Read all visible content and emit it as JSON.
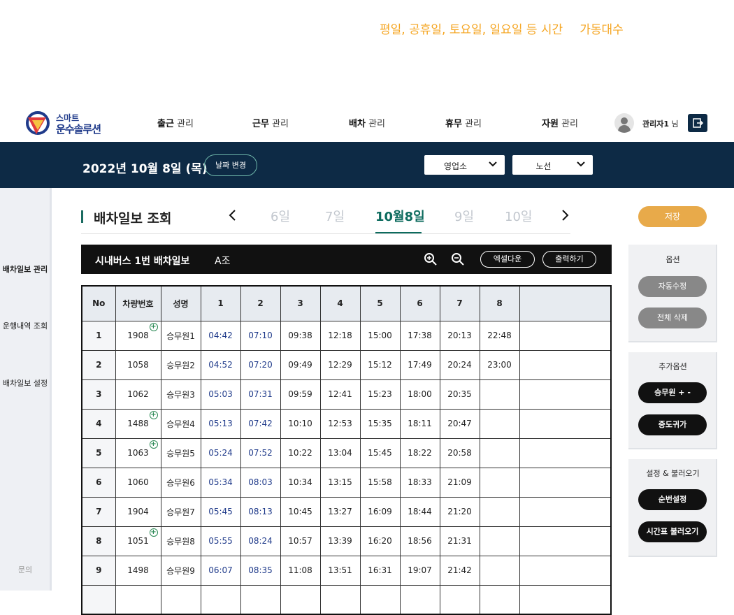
{
  "top_note": [
    "평일, 공휴일, 토요일, 일요일 등 시간",
    "가동대수"
  ],
  "logo": {
    "sub": "스마트",
    "main": "운수솔루션"
  },
  "menu": [
    {
      "bold": "출근",
      "rest": "관리"
    },
    {
      "bold": "근무",
      "rest": "관리"
    },
    {
      "bold": "배차",
      "rest": "관리"
    },
    {
      "bold": "휴무",
      "rest": "관리"
    },
    {
      "bold": "자원",
      "rest": "관리"
    }
  ],
  "user": {
    "name": "관리자1",
    "suffix": "님"
  },
  "datebar": {
    "date": "2022년 10월 8일 (목)",
    "change_label": "날짜 변경",
    "office_select": "영업소",
    "route_select": "노선"
  },
  "sidebar": {
    "items": [
      "배차일보 관리",
      "운행내역 조회",
      "배차일보 설정"
    ],
    "bottom": "문의"
  },
  "page": {
    "title": "배차일보 조회",
    "days": [
      "6일",
      "7일",
      "10월8일",
      "9일",
      "10일"
    ],
    "save_label": "저장"
  },
  "table_header": {
    "title": "시내버스 1번 배차일보",
    "group": "A조",
    "excel_label": "엑셀다운",
    "print_label": "출력하기"
  },
  "table": {
    "columns": [
      "No",
      "차량번호",
      "성명",
      "1",
      "2",
      "3",
      "4",
      "5",
      "6",
      "7",
      "8",
      ""
    ],
    "rows": [
      {
        "no": "1",
        "vehicle": "1908",
        "plus": true,
        "name": "승무원1",
        "times": [
          "04:42",
          "07:10",
          "09:38",
          "12:18",
          "15:00",
          "17:38",
          "20:13",
          "22:48"
        ]
      },
      {
        "no": "2",
        "vehicle": "1058",
        "plus": false,
        "name": "승무원2",
        "times": [
          "04:52",
          "07:20",
          "09:49",
          "12:29",
          "15:12",
          "17:49",
          "20:24",
          "23:00"
        ]
      },
      {
        "no": "3",
        "vehicle": "1062",
        "plus": false,
        "name": "승무원3",
        "times": [
          "05:03",
          "07:31",
          "09:59",
          "12:41",
          "15:23",
          "18:00",
          "20:35",
          ""
        ]
      },
      {
        "no": "4",
        "vehicle": "1488",
        "plus": true,
        "name": "승무원4",
        "times": [
          "05:13",
          "07:42",
          "10:10",
          "12:53",
          "15:35",
          "18:11",
          "20:47",
          ""
        ]
      },
      {
        "no": "5",
        "vehicle": "1063",
        "plus": true,
        "name": "승무원5",
        "times": [
          "05:24",
          "07:52",
          "10:22",
          "13:04",
          "15:45",
          "18:22",
          "20:58",
          ""
        ]
      },
      {
        "no": "6",
        "vehicle": "1060",
        "plus": false,
        "name": "승무원6",
        "times": [
          "05:34",
          "08:03",
          "10:34",
          "13:15",
          "15:58",
          "18:33",
          "21:09",
          ""
        ]
      },
      {
        "no": "7",
        "vehicle": "1904",
        "plus": false,
        "name": "승무원7",
        "times": [
          "05:45",
          "08:13",
          "10:45",
          "13:27",
          "16:09",
          "18:44",
          "21:20",
          ""
        ]
      },
      {
        "no": "8",
        "vehicle": "1051",
        "plus": true,
        "name": "승무원8",
        "times": [
          "05:55",
          "08:24",
          "10:57",
          "13:39",
          "16:20",
          "18:56",
          "21:31",
          ""
        ]
      },
      {
        "no": "9",
        "vehicle": "1498",
        "plus": false,
        "name": "승무원9",
        "times": [
          "06:07",
          "08:35",
          "11:08",
          "13:51",
          "16:31",
          "19:07",
          "21:42",
          ""
        ]
      }
    ]
  },
  "panels": {
    "options": {
      "title": "옵션",
      "buttons": [
        "자동수정",
        "전체 삭제"
      ]
    },
    "extra": {
      "title": "추가옵션",
      "buttons": [
        "승무원 + -",
        "중도귀가"
      ]
    },
    "settings": {
      "title": "설정 & 불러오기",
      "buttons": [
        "순번설정",
        "시간표 불러오기"
      ]
    }
  },
  "colors": {
    "accent_orange": "#f5a623",
    "navy": "#0d2a45",
    "teal": "#0d6b5e",
    "save": "#e8aa4a"
  }
}
